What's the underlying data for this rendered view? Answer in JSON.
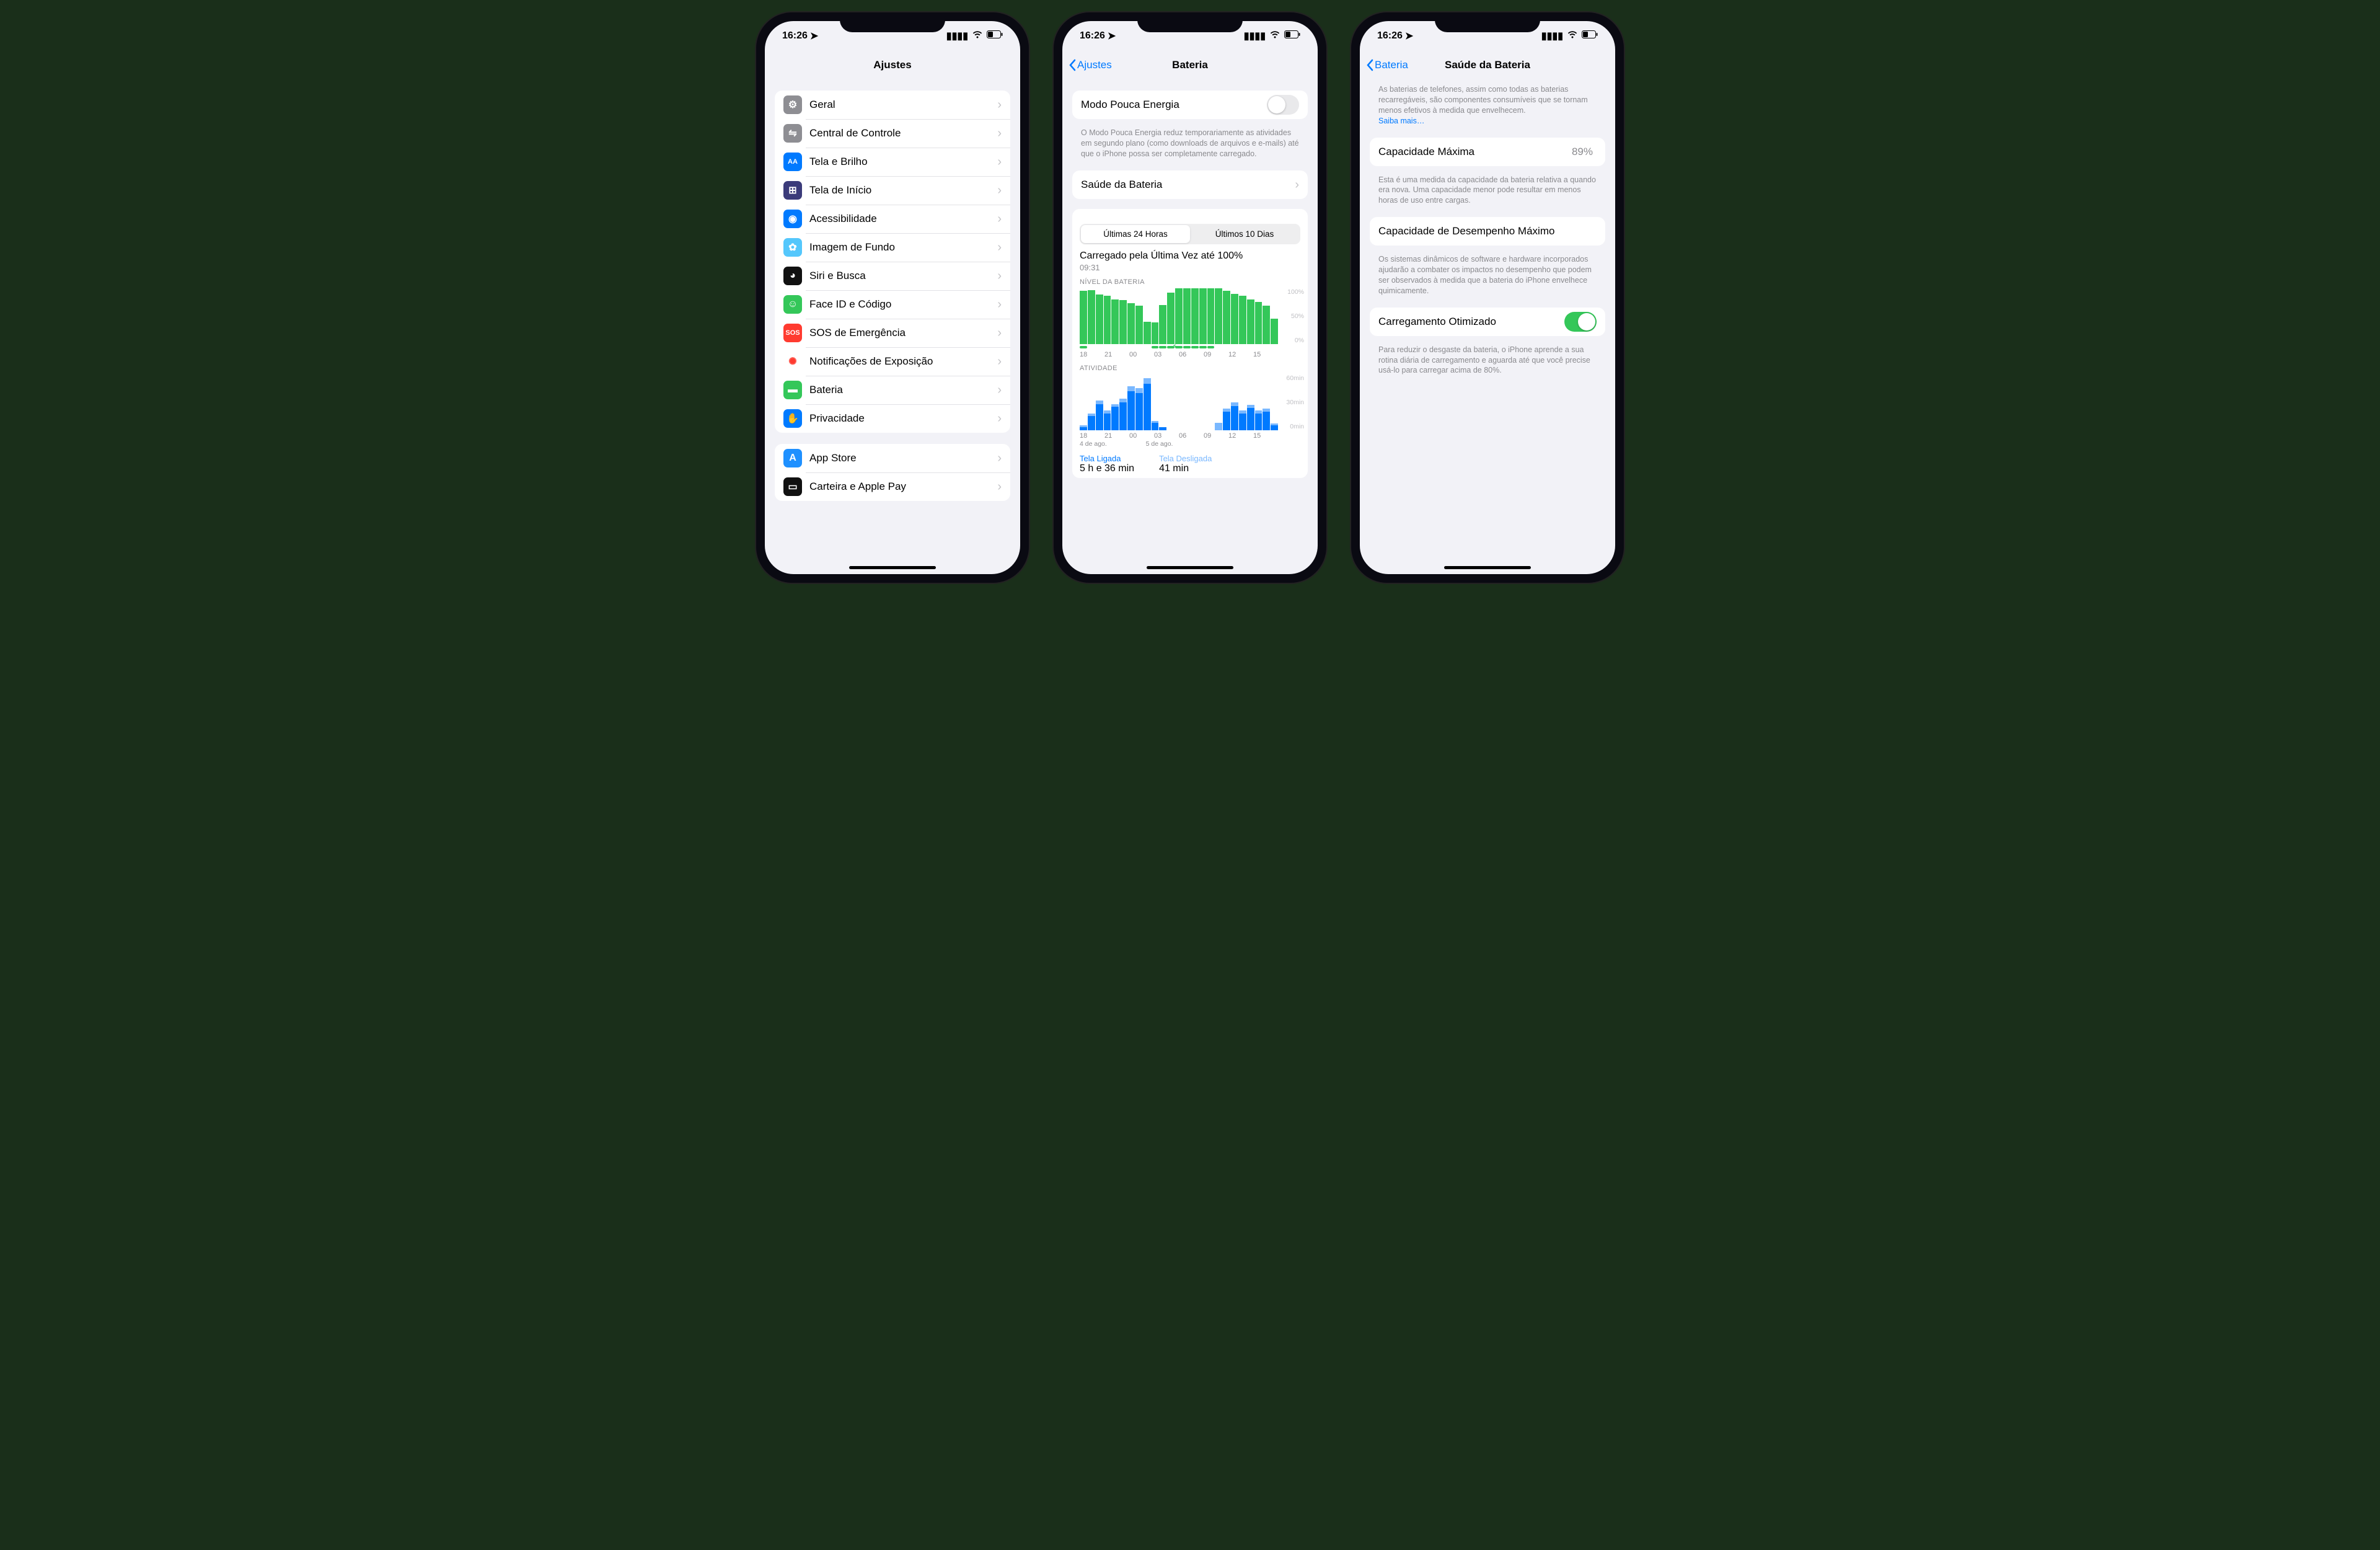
{
  "status": {
    "time": "16:26",
    "loc_icon": "location-arrow"
  },
  "phone1": {
    "title": "Ajustes",
    "groups": [
      {
        "items": [
          {
            "icon": "gear",
            "color": "#8e8e93",
            "label": "Geral"
          },
          {
            "icon": "switches",
            "color": "#8e8e93",
            "label": "Central de Controle"
          },
          {
            "icon": "AA",
            "color": "#007aff",
            "label": "Tela e Brilho"
          },
          {
            "icon": "grid",
            "color": "#3b3b7a",
            "label": "Tela de Início"
          },
          {
            "icon": "person",
            "color": "#007aff",
            "label": "Acessibilidade"
          },
          {
            "icon": "flower",
            "color": "#54c7fc",
            "label": "Imagem de Fundo"
          },
          {
            "icon": "siri",
            "color": "#111",
            "label": "Siri e Busca"
          },
          {
            "icon": "face",
            "color": "#34c759",
            "label": "Face ID e Código"
          },
          {
            "icon": "SOS",
            "color": "#ff3b30",
            "label": "SOS de Emergência"
          },
          {
            "icon": "virus",
            "color": "#fff",
            "fg": "#ff3b30",
            "label": "Notificações de Exposição"
          },
          {
            "icon": "battery",
            "color": "#34c759",
            "label": "Bateria"
          },
          {
            "icon": "hand",
            "color": "#007aff",
            "label": "Privacidade"
          }
        ]
      },
      {
        "items": [
          {
            "icon": "A",
            "color": "#1e90ff",
            "label": "App Store"
          },
          {
            "icon": "wallet",
            "color": "#111",
            "label": "Carteira e Apple Pay"
          }
        ]
      }
    ]
  },
  "phone2": {
    "back": "Ajustes",
    "title": "Bateria",
    "low_power": {
      "label": "Modo Pouca Energia",
      "on": false,
      "desc": "O Modo Pouca Energia reduz temporariamente as atividades em segundo plano (como downloads de arquivos e e-mails) até que o iPhone possa ser completamente carregado."
    },
    "health": {
      "label": "Saúde da Bateria"
    },
    "seg": {
      "a": "Últimas 24 Horas",
      "b": "Últimos 10 Dias",
      "active": 0
    },
    "last_charge": {
      "title": "Carregado pela Última Vez até 100%",
      "time": "09:31"
    },
    "level": {
      "caption": "NÍVEL DA BATERIA",
      "ylabels": [
        "100%",
        "50%",
        "0%"
      ]
    },
    "activity": {
      "caption": "ATIVIDADE",
      "ylabels": [
        "60min",
        "30min",
        "0min"
      ]
    },
    "xaxis": [
      "18",
      "21",
      "00",
      "03",
      "06",
      "09",
      "12",
      "15"
    ],
    "xdates": [
      "4 de ago.",
      "5 de ago."
    ],
    "legend": {
      "on_label": "Tela Ligada",
      "on_val": "5 h e 36 min",
      "off_label": "Tela Desligada",
      "off_val": "41 min"
    }
  },
  "phone3": {
    "back": "Bateria",
    "title": "Saúde da Bateria",
    "intro": "As baterias de telefones, assim como todas as baterias recarregáveis, são componentes consumíveis que se tornam menos efetivos à medida que envelhecem.",
    "learn": "Saiba mais…",
    "capacity": {
      "label": "Capacidade Máxima",
      "value": "89%",
      "desc": "Esta é uma medida da capacidade da bateria relativa a quando era nova. Uma capacidade menor pode resultar em menos horas de uso entre cargas."
    },
    "peak": {
      "label": "Capacidade de Desempenho Máximo",
      "desc": "Os sistemas dinâmicos de software e hardware incorporados ajudarão a combater os impactos no desempenho que podem ser observados à medida que a bateria do iPhone envelhece quimicamente."
    },
    "optim": {
      "label": "Carregamento Otimizado",
      "on": true,
      "desc": "Para reduzir o desgaste da bateria, o iPhone aprende a sua rotina diária de carregamento e aguarda até que você precise usá-lo para carregar acima de 80%."
    }
  },
  "chart_data": [
    {
      "type": "bar",
      "title": "NÍVEL DA BATERIA",
      "categories": [
        "16",
        "17",
        "18",
        "19",
        "20",
        "21",
        "22",
        "23",
        "00",
        "01",
        "02",
        "03",
        "04",
        "05",
        "06",
        "07",
        "08",
        "09",
        "10",
        "11",
        "12",
        "13",
        "14",
        "15",
        "16"
      ],
      "values": [
        95,
        96,
        88,
        86,
        80,
        78,
        73,
        68,
        40,
        38,
        70,
        92,
        100,
        100,
        100,
        100,
        100,
        100,
        95,
        90,
        86,
        80,
        75,
        68,
        45
      ],
      "ylim": [
        0,
        100
      ],
      "ylabel": "%"
    },
    {
      "type": "bar",
      "title": "ATIVIDADE",
      "categories": [
        "16",
        "17",
        "18",
        "19",
        "20",
        "21",
        "22",
        "23",
        "00",
        "01",
        "02",
        "03",
        "04",
        "05",
        "06",
        "07",
        "08",
        "09",
        "10",
        "11",
        "12",
        "13",
        "14",
        "15",
        "16"
      ],
      "series": [
        {
          "name": "Tela Ligada",
          "values": [
            3,
            15,
            28,
            18,
            25,
            30,
            42,
            40,
            50,
            8,
            3,
            0,
            0,
            0,
            0,
            0,
            0,
            0,
            20,
            26,
            18,
            24,
            18,
            20,
            5
          ]
        },
        {
          "name": "Tela Desligada",
          "values": [
            2,
            3,
            4,
            3,
            3,
            4,
            5,
            5,
            6,
            2,
            0,
            0,
            0,
            0,
            0,
            0,
            0,
            8,
            3,
            4,
            3,
            3,
            3,
            3,
            2
          ]
        }
      ],
      "ylim": [
        0,
        60
      ],
      "ylabel": "min"
    }
  ]
}
